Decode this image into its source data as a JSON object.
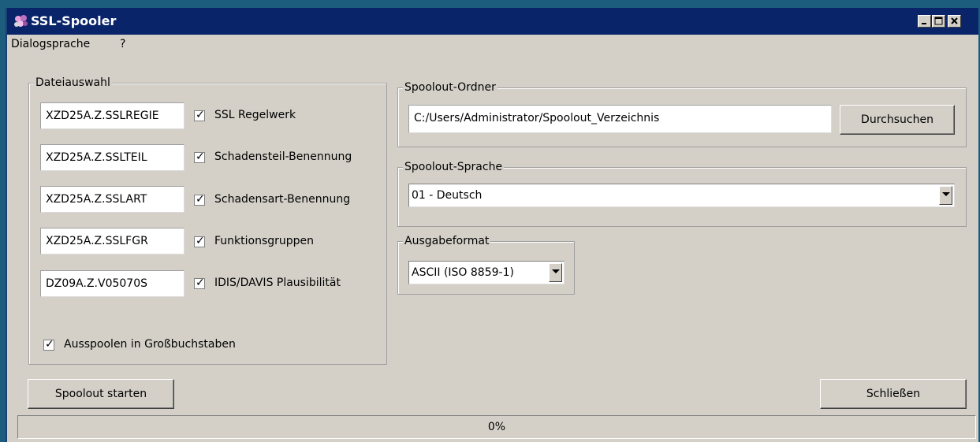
{
  "window": {
    "title": "SSL-Spooler"
  },
  "menu": {
    "items": [
      "Dialogsprache",
      "?"
    ]
  },
  "dateiauswahl": {
    "title": "Dateiauswahl",
    "rows": [
      {
        "file": "XZD25A.Z.SSLREGIE",
        "checked": true,
        "label": "SSL Regelwerk"
      },
      {
        "file": "XZD25A.Z.SSLTEIL",
        "checked": true,
        "label": "Schadensteil-Benennung"
      },
      {
        "file": "XZD25A.Z.SSLART",
        "checked": true,
        "label": "Schadensart-Benennung"
      },
      {
        "file": "XZD25A.Z.SSLFGR",
        "checked": true,
        "label": "Funktionsgruppen"
      },
      {
        "file": "DZ09A.Z.V05070S",
        "checked": true,
        "label": "IDIS/DAVIS Plausibilität"
      }
    ],
    "uppercase": {
      "checked": true,
      "label": "Ausspoolen in Großbuchstaben"
    }
  },
  "spoolout_ordner": {
    "title": "Spoolout-Ordner",
    "path": "C:/Users/Administrator/Spoolout_Verzeichnis",
    "browse_label": "Durchsuchen"
  },
  "spoolout_sprache": {
    "title": "Spoolout-Sprache",
    "selected": "01 - Deutsch"
  },
  "ausgabeformat": {
    "title": "Ausgabeformat",
    "selected": "ASCII (ISO 8859-1)"
  },
  "buttons": {
    "start": "Spoolout starten",
    "close": "Schließen"
  },
  "progress": {
    "value": 0,
    "text": "0%"
  },
  "check_glyph": "✓",
  "colors": {
    "titlebar": "#0a246a",
    "window_bg": "#d4d0c8",
    "desktop": "#1c5d7e"
  }
}
